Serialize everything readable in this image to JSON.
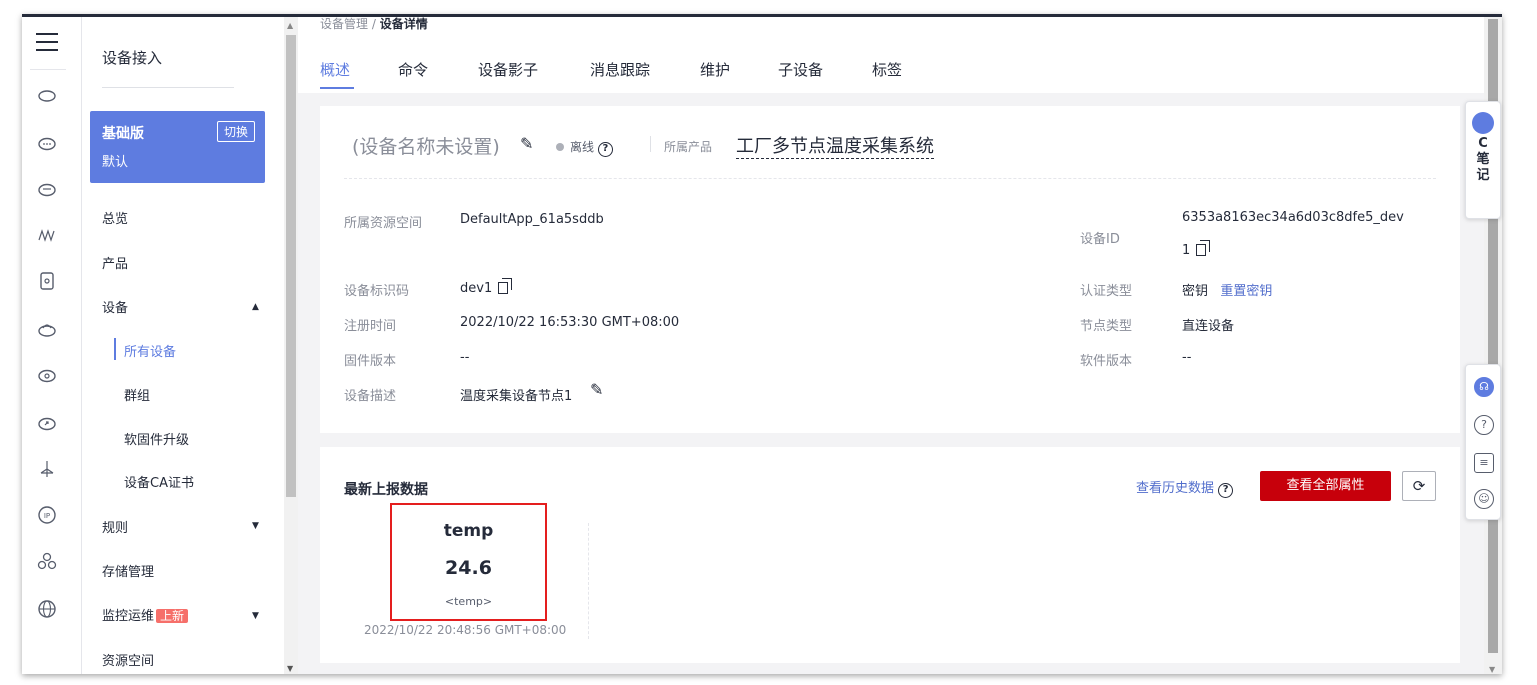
{
  "sidebar": {
    "title": "设备接入",
    "plan": {
      "name": "基础版",
      "desc": "默认",
      "switch_label": "切换"
    },
    "items": [
      {
        "label": "总览"
      },
      {
        "label": "产品"
      },
      {
        "label": "设备"
      },
      {
        "label": "所有设备"
      },
      {
        "label": "群组"
      },
      {
        "label": "软固件升级"
      },
      {
        "label": "设备CA证书"
      },
      {
        "label": "规则"
      },
      {
        "label": "存储管理"
      },
      {
        "label": "监控运维",
        "badge": "上新"
      },
      {
        "label": "资源空间"
      }
    ]
  },
  "breadcrumb": {
    "parent": "设备管理 / ",
    "current": "设备详情"
  },
  "tabs": [
    "概述",
    "命令",
    "设备影子",
    "消息跟踪",
    "维护",
    "子设备",
    "标签"
  ],
  "device": {
    "name": "(设备名称未设置)",
    "status": "离线",
    "product_label": "所属产品",
    "product": "工厂多节点温度采集系统",
    "fields": {
      "space_label": "所属资源空间",
      "space": "DefaultApp_61a5sddb",
      "id_label": "设备ID",
      "id_line1": "6353a8163ec34a6d03c8dfe5_dev",
      "id_line2": "1",
      "code_label": "设备标识码",
      "code": "dev1",
      "auth_label": "认证类型",
      "auth": "密钥",
      "reset": "重置密钥",
      "reg_label": "注册时间",
      "reg": "2022/10/22 16:53:30 GMT+08:00",
      "node_label": "节点类型",
      "node": "直连设备",
      "fw_label": "固件版本",
      "fw": "--",
      "sw_label": "软件版本",
      "sw": "--",
      "desc_label": "设备描述",
      "desc": "温度采集设备节点1"
    }
  },
  "latest": {
    "title": "最新上报数据",
    "history": "查看历史数据",
    "all_props": "查看全部属性",
    "refresh_icon": "refresh-icon",
    "prop": {
      "name": "temp",
      "value": "24.6",
      "key": "<temp>",
      "time": "2022/10/22 20:48:56 GMT+08:00"
    }
  },
  "float": {
    "notes": "C笔记",
    "help_icons": [
      "headset-icon",
      "help-icon",
      "feedback-icon",
      "smile-icon"
    ]
  },
  "colors": {
    "accent": "#5e7ce0",
    "danger": "#c7000b",
    "highlight": "#e41e1e"
  }
}
